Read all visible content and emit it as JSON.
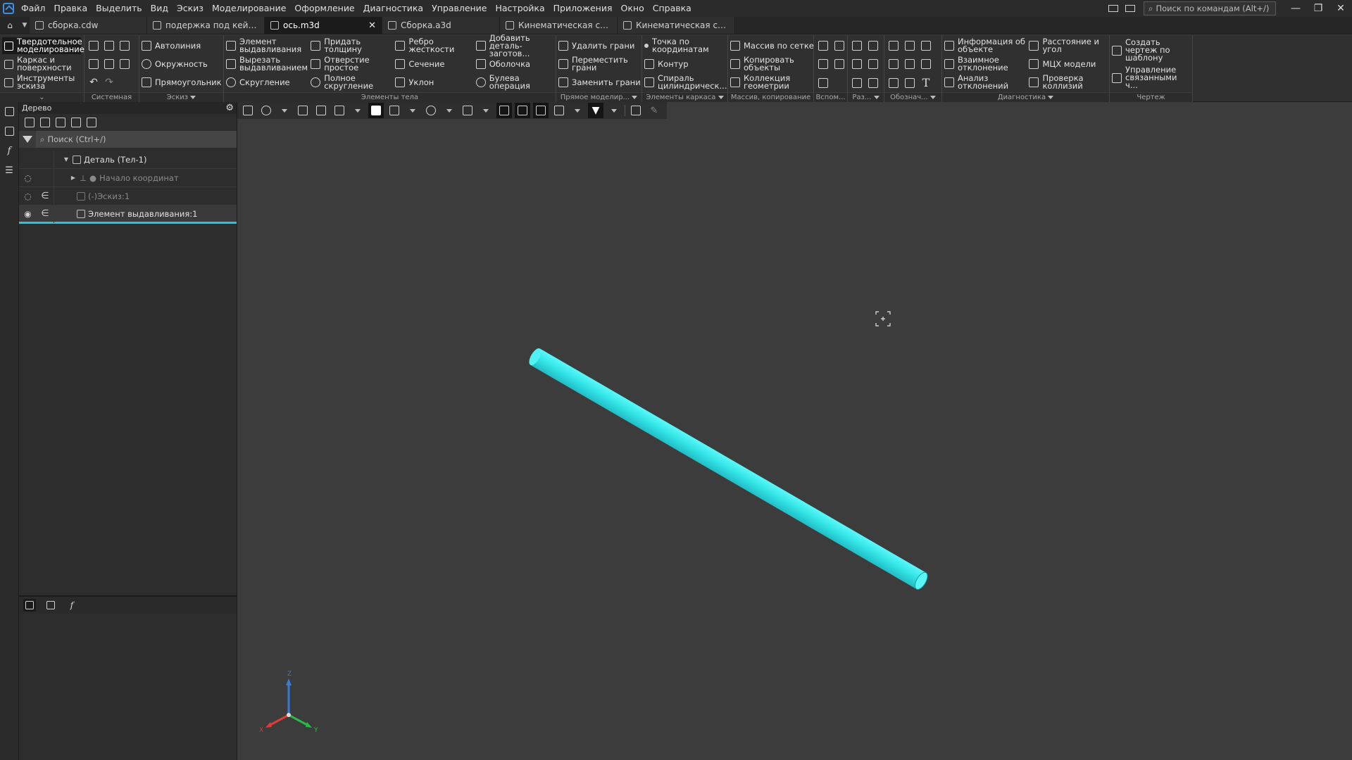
{
  "menu": [
    "Файл",
    "Правка",
    "Выделить",
    "Вид",
    "Эскиз",
    "Моделирование",
    "Оформление",
    "Диагностика",
    "Управление",
    "Настройка",
    "Приложения",
    "Окно",
    "Справка"
  ],
  "search_commands": {
    "placeholder": "Поиск по командам (Alt+/)"
  },
  "tabs": [
    {
      "label": "сборка.cdw",
      "active": false
    },
    {
      "label": "подержка под кейс...",
      "active": false
    },
    {
      "label": "ось.m3d",
      "active": true,
      "close": "✕"
    },
    {
      "label": "Сборка.a3d",
      "active": false
    },
    {
      "label": "Кинематическая схе...",
      "active": false
    },
    {
      "label": "Кинематическая схе...",
      "active": false
    }
  ],
  "ribbon": {
    "modes": [
      "Твердотельное моделирование",
      "Каркас и поверхности",
      "Инструменты эскиза"
    ],
    "groups": {
      "system": "Системная",
      "sketch": {
        "title": "Эскиз",
        "items": [
          "Автолиния",
          "Окружность",
          "Прямоугольник"
        ]
      },
      "body": {
        "title": "Элементы тела",
        "items": [
          "Элемент выдавливания",
          "Вырезать выдавливанием",
          "Скругление",
          "Придать толщину",
          "Отверстие простое",
          "Полное скругление",
          "Ребро жесткости",
          "Сечение",
          "Уклон",
          "Добавить деталь-заготов...",
          "Оболочка",
          "Булева операция"
        ]
      },
      "direct": {
        "title": "Прямое моделир...",
        "items": [
          "Удалить грани",
          "Переместить грани",
          "Заменить грани"
        ]
      },
      "frame": {
        "title": "Элементы каркаса",
        "items": [
          "Точка по координатам",
          "Контур",
          "Спираль цилиндрическ..."
        ]
      },
      "array": {
        "title": "Массив, копирование",
        "items": [
          "Массив по сетке",
          "Копировать объекты",
          "Коллекция геометрии"
        ]
      },
      "aux": {
        "title": "Вспом..."
      },
      "dims": {
        "title": "Раз..."
      },
      "notation": {
        "title": "Обознач..."
      },
      "diag": {
        "title": "Диагностика",
        "items": [
          "Информация об объекте",
          "Взаимное отклонение",
          "Анализ отклонений",
          "Расстояние и угол",
          "МЦХ модели",
          "Проверка коллизий"
        ]
      },
      "drawing": {
        "title": "Чертеж",
        "items": [
          "Создать чертеж по шаблону",
          "Управление связанными ч..."
        ]
      }
    }
  },
  "tree": {
    "title": "Дерево",
    "search_placeholder": "Поиск (Ctrl+/)",
    "nodes": [
      {
        "label": "Деталь (Тел-1)"
      },
      {
        "label": "Начало координат"
      },
      {
        "label": "(-)Эскиз:1"
      },
      {
        "label": "Элемент выдавливания:1"
      }
    ]
  },
  "colors": {
    "model": "#34e6e8",
    "selection": "#29c3e0",
    "axis_z": "#3a7bd5",
    "axis_x": "#e03a3a",
    "axis_y": "#2eb84a"
  },
  "triad": {
    "x": "X",
    "y": "Y",
    "z": "Z"
  }
}
